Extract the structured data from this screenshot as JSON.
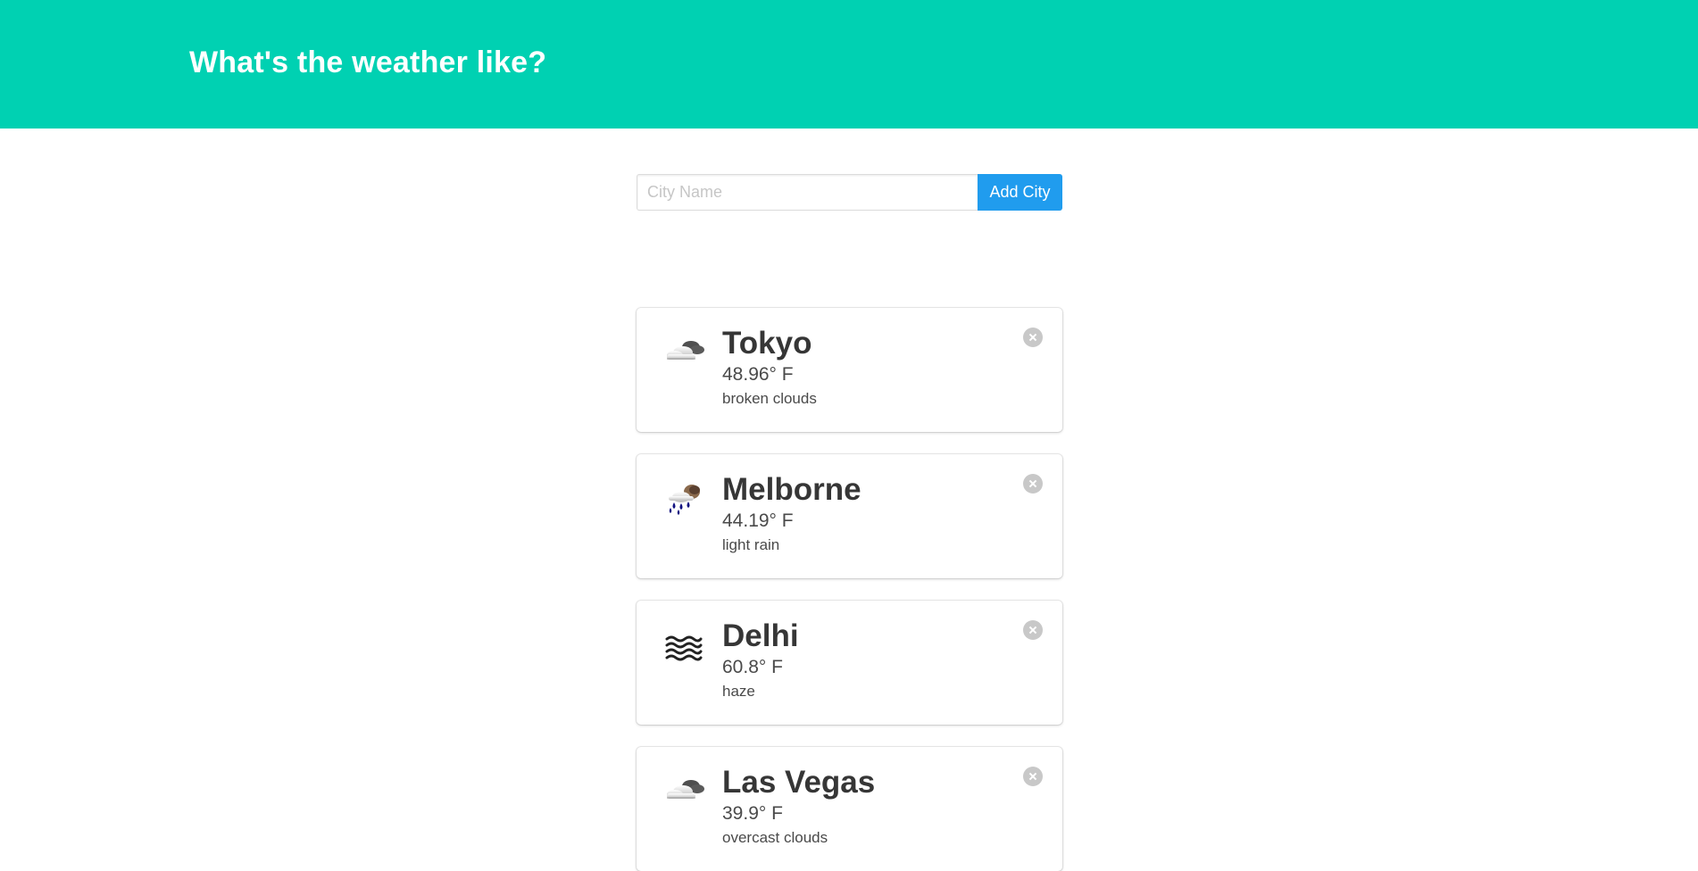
{
  "header": {
    "title": "What's the weather like?",
    "background_color": "#00d1b2"
  },
  "search": {
    "placeholder": "City Name",
    "value": "",
    "button_label": "Add City",
    "button_color": "#209cee"
  },
  "cities": [
    {
      "name": "Tokyo",
      "temperature": "48.96° F",
      "description": "broken clouds",
      "icon": "broken-clouds-icon"
    },
    {
      "name": "Melborne",
      "temperature": "44.19° F",
      "description": "light rain",
      "icon": "light-rain-icon"
    },
    {
      "name": "Delhi",
      "temperature": "60.8° F",
      "description": "haze",
      "icon": "haze-icon"
    },
    {
      "name": "Las Vegas",
      "temperature": "39.9° F",
      "description": "overcast clouds",
      "icon": "overcast-clouds-icon"
    }
  ]
}
